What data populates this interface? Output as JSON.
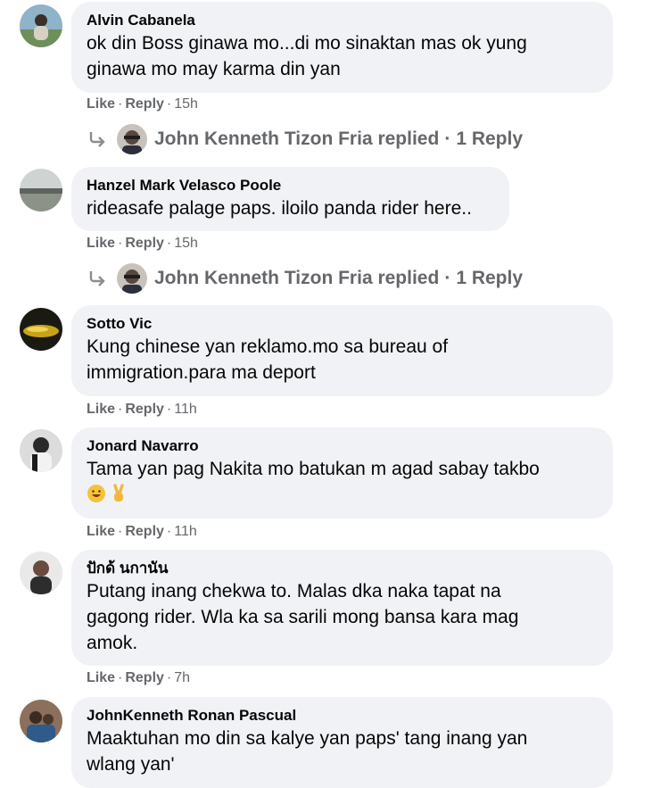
{
  "comments": [
    {
      "author": "Alvin Cabanela",
      "lines": [
        "ok din Boss ginawa mo...di mo sinaktan mas ok yung",
        "ginawa mo may karma din yan"
      ],
      "like": "Like",
      "reply": "Reply",
      "time": "15h",
      "replies": {
        "name": "John Kenneth Tizon Fria replied",
        "count": "1 Reply"
      }
    },
    {
      "author": "Hanzel Mark Velasco Poole",
      "lines": [
        "rideasafe palage paps. iloilo panda rider here.."
      ],
      "like": "Like",
      "reply": "Reply",
      "time": "15h",
      "replies": {
        "name": "John Kenneth Tizon Fria replied",
        "count": "1 Reply"
      }
    },
    {
      "author": "Sotto Vic",
      "lines": [
        "Kung chinese yan reklamo.mo sa bureau of",
        "immigration.para ma deport"
      ],
      "like": "Like",
      "reply": "Reply",
      "time": "11h"
    },
    {
      "author": "Jonard Navarro",
      "lines": [
        "Tama yan pag Nakita mo batukan m agad sabay takbo"
      ],
      "emojis": [
        "grinning-face-emoji",
        "victory-hand-emoji"
      ],
      "like": "Like",
      "reply": "Reply",
      "time": "11h"
    },
    {
      "author": "ปักด้ นกานัน",
      "lines": [
        "Putang inang chekwa to. Malas dka naka tapat na",
        "gagong rider. Wla ka sa sarili mong bansa kara mag",
        "amok."
      ],
      "like": "Like",
      "reply": "Reply",
      "time": "7h"
    },
    {
      "author": "JohnKenneth Ronan Pascual",
      "lines": [
        "Maaktuhan mo din sa kalye yan paps' tang inang yan",
        "wlang yan'"
      ]
    }
  ],
  "colors": {
    "bubble": "#f0f2f5",
    "meta": "#65676b",
    "text": "#050505"
  },
  "icons": {
    "reply_arrow": "reply-arrow-icon"
  }
}
